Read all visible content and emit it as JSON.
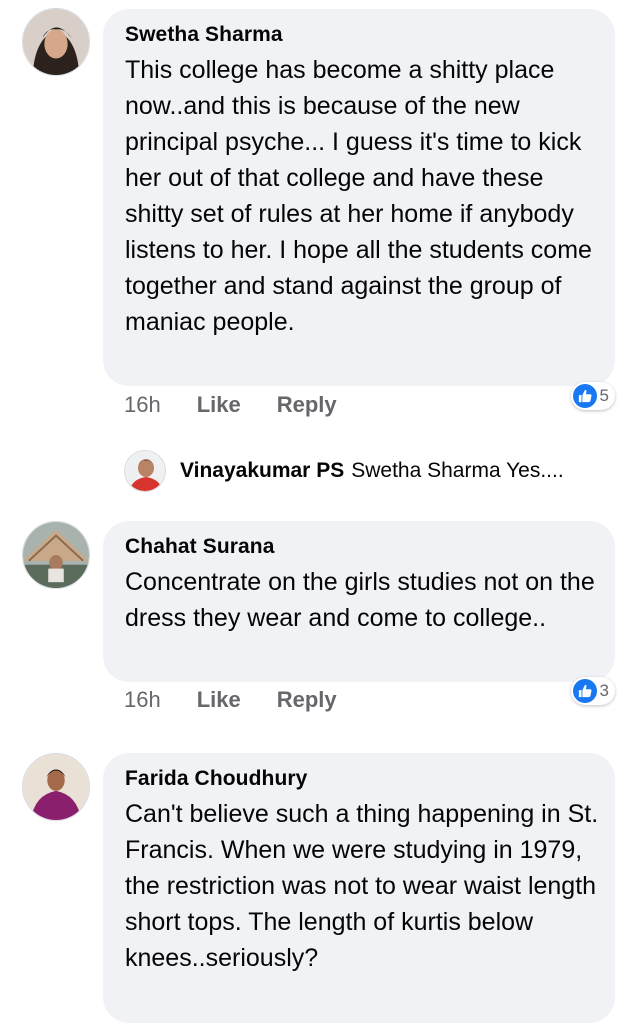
{
  "comments": [
    {
      "author": "Swetha Sharma",
      "text": "This college has become a shitty place now..and this is because of the new principal psyche... I guess it's time to kick her out of that college and have these shitty set of rules at her home if anybody listens to her. I hope all the students come together and stand against the group of maniac people.",
      "time": "16h",
      "like_label": "Like",
      "reply_label": "Reply",
      "reactions": "5",
      "reaction_icon": "like-icon"
    },
    {
      "author": "Chahat Surana",
      "text": "Concentrate on the girls studies not on the dress they wear and come to college..",
      "time": "16h",
      "like_label": "Like",
      "reply_label": "Reply",
      "reactions": "3",
      "reaction_icon": "like-icon"
    },
    {
      "author": "Farida Choudhury",
      "text": "Can't believe such a thing happening in St. Francis. When we were studying in 1979, the restriction was not to wear waist length short tops. The length of kurtis below knees..seriously?"
    }
  ],
  "reply": {
    "author": "Vinayakumar PS",
    "text": "Swetha Sharma Yes...."
  },
  "colors": {
    "bubble": "#f0f2f5",
    "meta_text": "#65676b",
    "like_blue": "#1877f2"
  }
}
